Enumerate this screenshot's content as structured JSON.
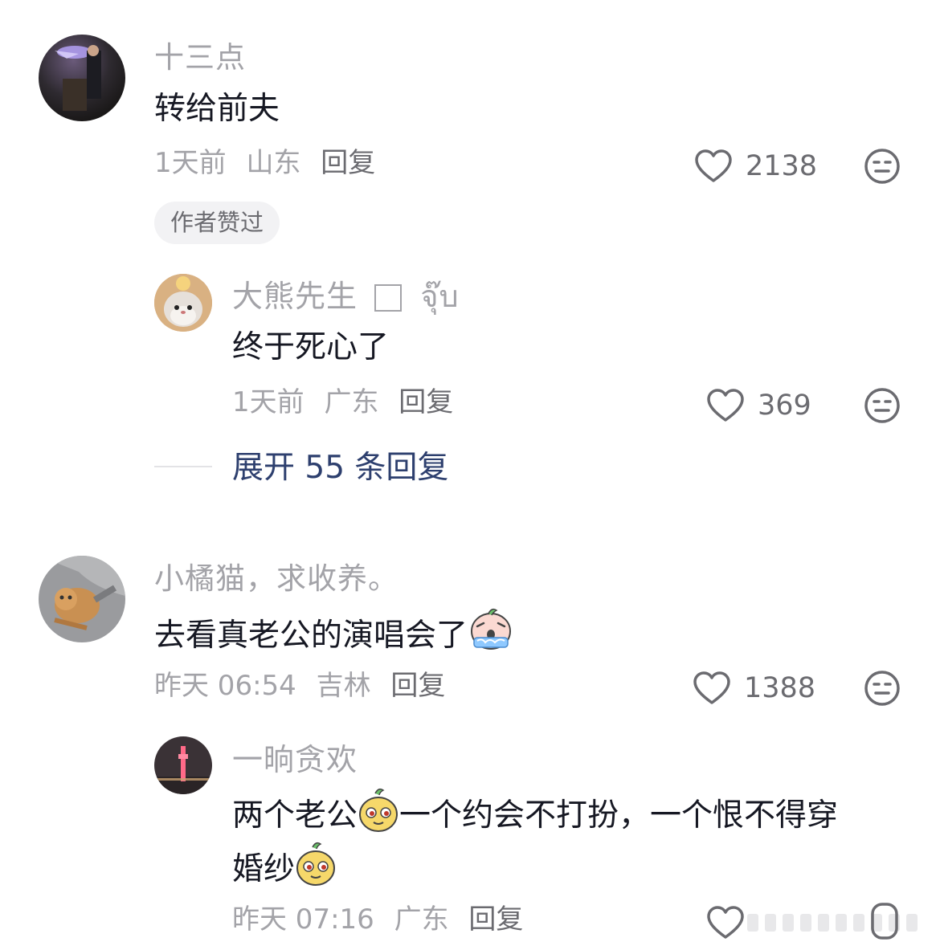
{
  "comments": [
    {
      "username": "十三点",
      "text": "转给前夫",
      "time": "1天前",
      "location": "山东",
      "reply_label": "回复",
      "likes": "2138",
      "badge": "作者赞过",
      "replies": [
        {
          "username": "大熊先生",
          "username_suffix": "จุ๊บ",
          "text": "终于死心了",
          "time": "1天前",
          "location": "广东",
          "reply_label": "回复",
          "likes": "369"
        }
      ],
      "expand_label": "展开 55 条回复"
    },
    {
      "username": "小橘猫，求收养。",
      "text": "去看真老公的演唱会了",
      "emoji": "crying-face-emoji",
      "time": "昨天 06:54",
      "location": "吉林",
      "reply_label": "回复",
      "likes": "1388",
      "replies": [
        {
          "username": "一晌贪欢",
          "text_part1": "两个老公",
          "text_part2": "一个约会不打扮，一个恨不得穿",
          "text_part3": "婚纱",
          "emoji": "smug-face-emoji",
          "time": "昨天 07:16",
          "location": "广东",
          "reply_label": "回复"
        }
      ]
    }
  ],
  "colors": {
    "primary_text": "#161823",
    "secondary_text": "#a3a3a8",
    "link": "#2d3f6e",
    "icon": "#6b6b70"
  }
}
